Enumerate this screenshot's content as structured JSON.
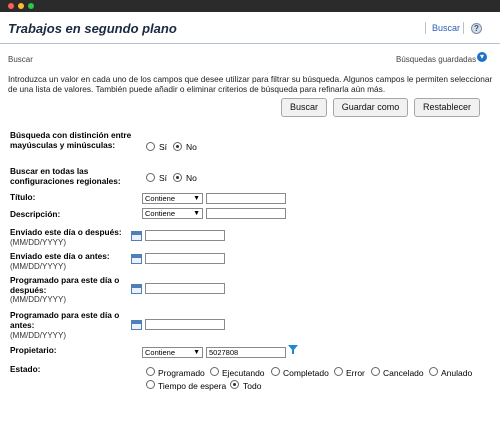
{
  "header": {
    "title": "Trabajos en segundo plano",
    "search_link": "Buscar",
    "help_icon": "help-icon"
  },
  "breadcrumb": "Buscar",
  "saved_searches": "Búsquedas guardadas",
  "intro": "Introduzca un valor en cada uno de los campos que desee utilizar para filtrar su búsqueda. Algunos campos le permiten seleccionar de una lista de valores. También puede añadir o eliminar criterios de búsqueda para refinarla aún más.",
  "buttons": {
    "search": "Buscar",
    "save_as": "Guardar como",
    "reset": "Restablecer"
  },
  "fields": {
    "case_sensitive": {
      "label": "Búsqueda con distinción entre mayúsculas y minúsculas:",
      "yes": "Sí",
      "no": "No",
      "selected": "No"
    },
    "regional": {
      "label": "Buscar en todas las configuraciones regionales:",
      "yes": "Sí",
      "no": "No",
      "selected": "No"
    },
    "title": {
      "label": "Título:",
      "operator": "Contiene",
      "value": ""
    },
    "description": {
      "label": "Descripción:",
      "operator": "Contiene",
      "value": ""
    },
    "sent_after": {
      "label": "Enviado este día o después:",
      "hint": "(MM/DD/YYYY)"
    },
    "sent_before": {
      "label": "Enviado este día o antes:",
      "hint": "(MM/DD/YYYY)"
    },
    "scheduled_after": {
      "label": "Programado para este día o después:",
      "hint": "(MM/DD/YYYY)"
    },
    "scheduled_before": {
      "label": "Programado para este día o antes:",
      "hint": "(MM/DD/YYYY)"
    },
    "owner": {
      "label": "Propietario:",
      "operator": "Contiene",
      "value": "5027808"
    },
    "status": {
      "label": "Estado:",
      "options": [
        "Programado",
        "Ejecutando",
        "Completado",
        "Error",
        "Cancelado",
        "Anulado",
        "Tiempo de espera",
        "Todo"
      ],
      "selected": "Todo"
    }
  }
}
